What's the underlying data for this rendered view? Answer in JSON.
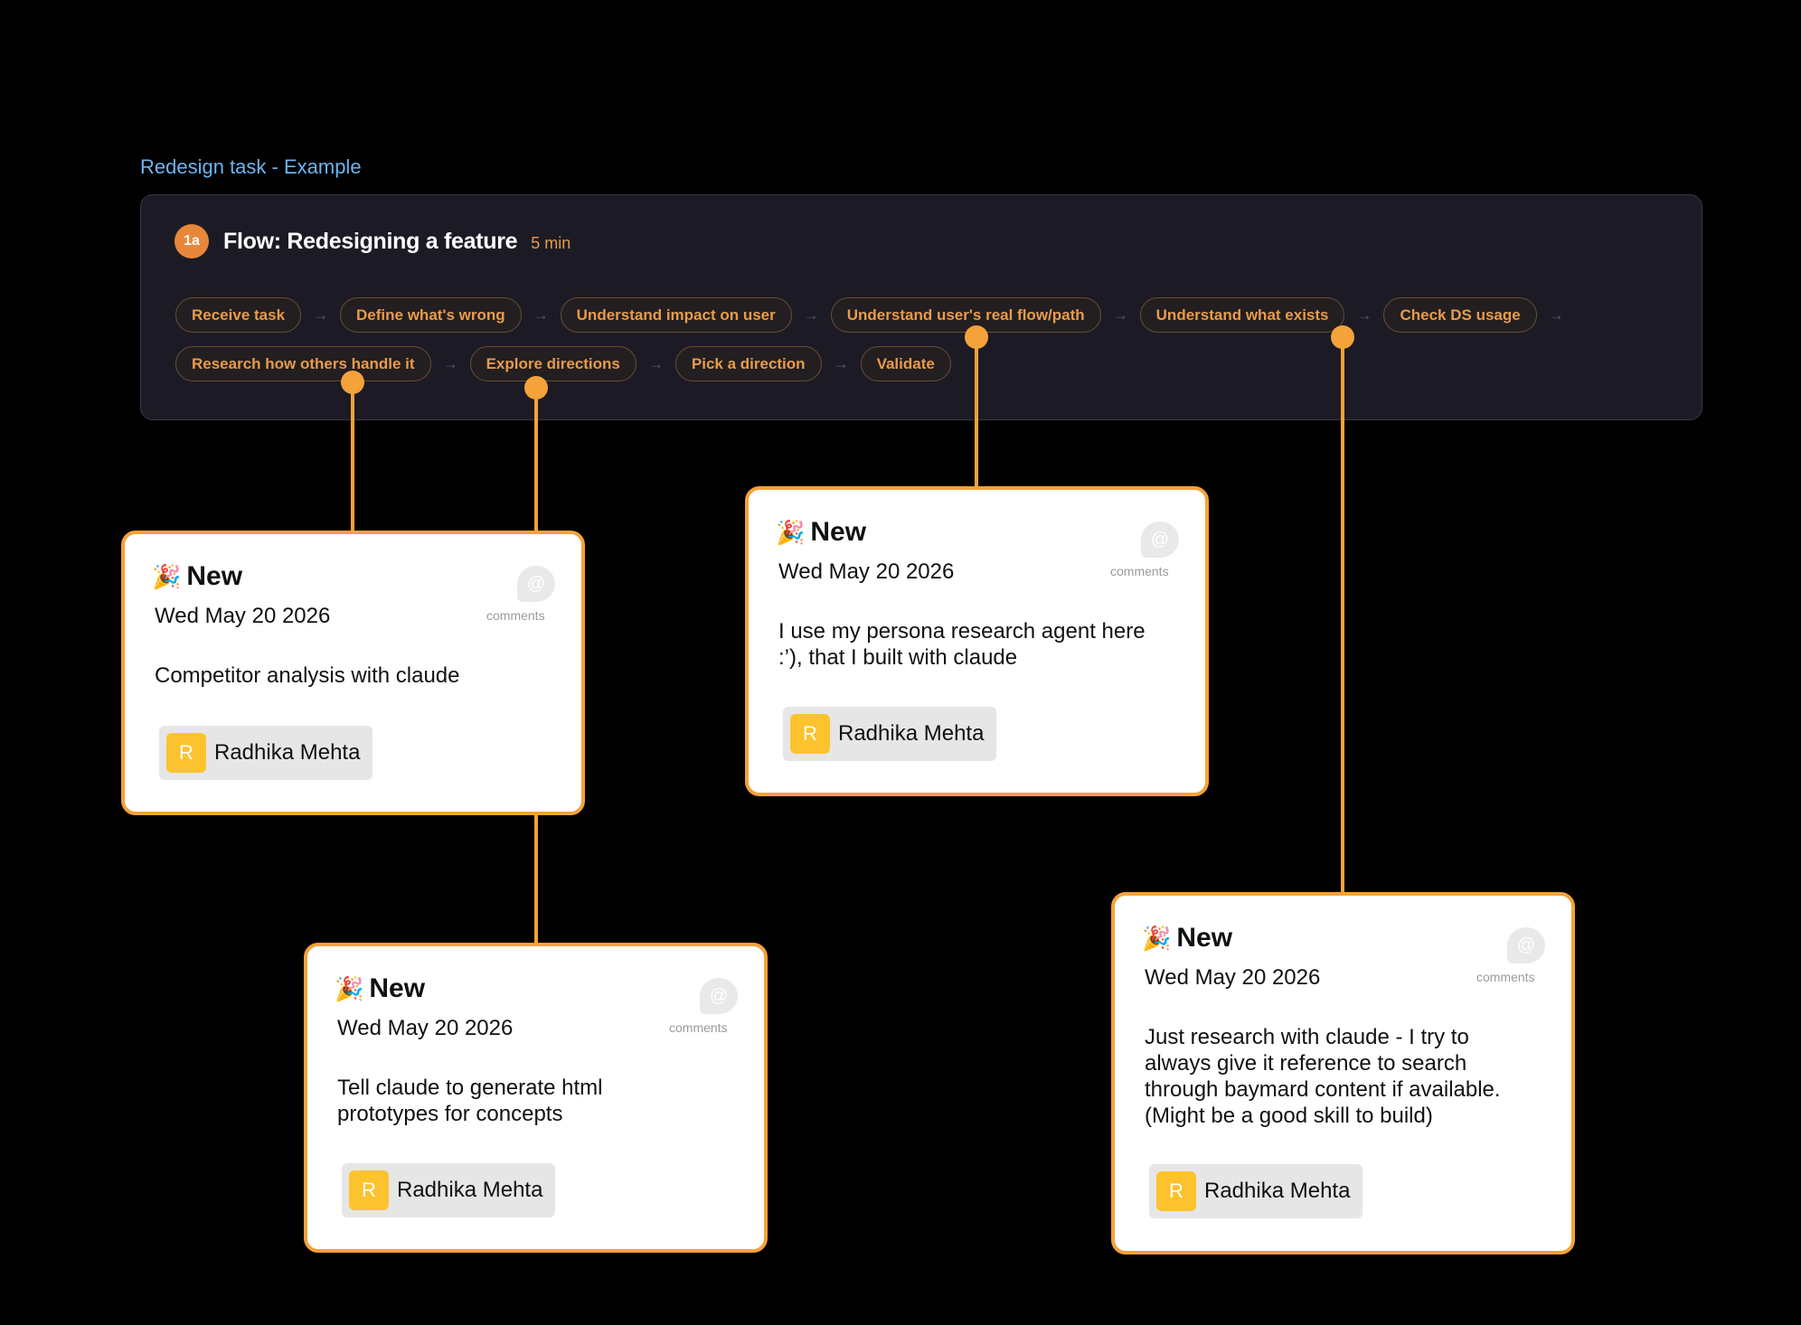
{
  "frame_label": "Redesign task - Example",
  "flow": {
    "step": "1a",
    "title": "Flow: Redesigning a feature",
    "duration": "5 min",
    "arrow": "→",
    "steps_row1": [
      "Receive task",
      "Define what's wrong",
      "Understand impact on user",
      "Understand user's real flow/path",
      "Understand what exists",
      "Check DS usage"
    ],
    "steps_row2": [
      "Research how others handle it",
      "Explore directions",
      "Pick a direction",
      "Validate"
    ]
  },
  "colors": {
    "accent": "#f4a23a",
    "pill_text": "#e89b4a",
    "badge": "#e8873a",
    "avatar": "#fcc32e",
    "frame_label": "#6cb5f2"
  },
  "cards": [
    {
      "status": "New",
      "date": "Wed May 20 2026",
      "comments_label": "comments",
      "comment_icon": "@",
      "body": [
        "Competitor analysis with claude"
      ],
      "author_initial": "R",
      "author": "Radhika Mehta",
      "attached_to": "Research how others handle it"
    },
    {
      "status": "New",
      "date": "Wed May 20 2026",
      "comments_label": "comments",
      "comment_icon": "@",
      "body": [
        "I use my persona research agent here",
        ":’), that I built with claude"
      ],
      "author_initial": "R",
      "author": "Radhika Mehta",
      "attached_to": "Understand user's real flow/path"
    },
    {
      "status": "New",
      "date": "Wed May 20 2026",
      "comments_label": "comments",
      "comment_icon": "@",
      "body": [
        "Tell claude to generate html",
        "prototypes for concepts"
      ],
      "author_initial": "R",
      "author": "Radhika Mehta",
      "attached_to": "Explore directions"
    },
    {
      "status": "New",
      "date": "Wed May 20 2026",
      "comments_label": "comments",
      "comment_icon": "@",
      "body": [
        "Just research with claude - I try to",
        "always give it reference to search",
        "through baymard content if available.",
        "(Might be a good skill to build)"
      ],
      "author_initial": "R",
      "author": "Radhika Mehta",
      "attached_to": "Understand what exists"
    }
  ]
}
